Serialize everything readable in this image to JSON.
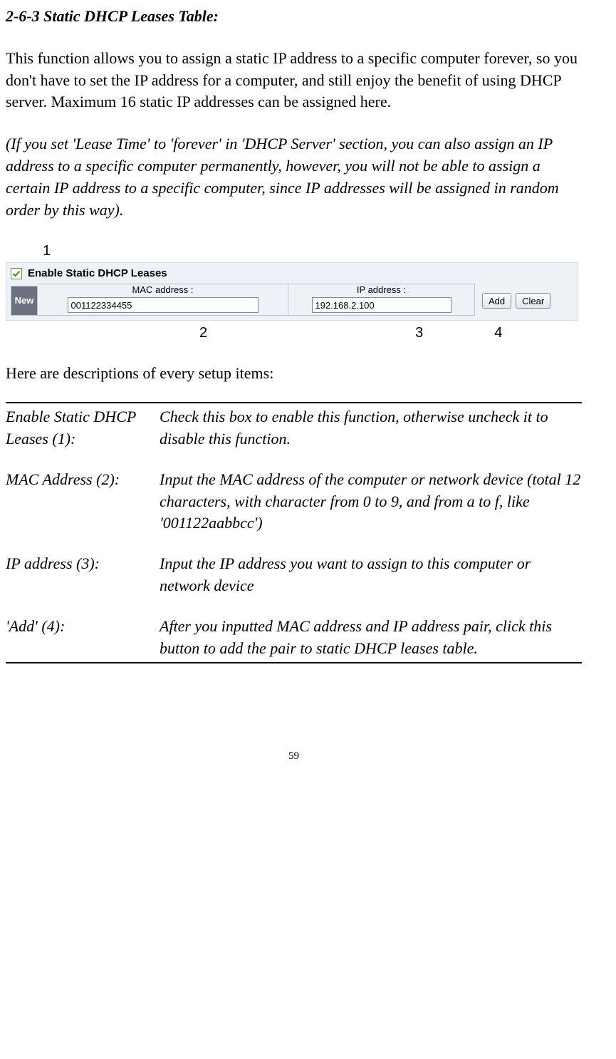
{
  "heading": "2-6-3 Static DHCP Leases Table:",
  "para1": "This function allows you to assign a static IP address to a specific computer forever, so you don't have to set the IP address for a computer, and still enjoy the benefit of using DHCP server. Maximum 16 static IP addresses can be assigned here.",
  "para2": "(If you set 'Lease Time' to 'forever' in 'DHCP Server' section, you can also assign an IP address to a specific computer permanently, however, you will not be able to assign a certain IP address to a specific computer, since IP addresses will be assigned in random order by this way).",
  "callout": {
    "c1": "1",
    "c2": "2",
    "c3": "3",
    "c4": "4"
  },
  "dhcp": {
    "enable_label": "Enable Static DHCP Leases",
    "mac_header": "MAC address :",
    "ip_header": "IP address :",
    "new_label": "New",
    "mac_value": "001122334455",
    "ip_value": "192.168.2.100",
    "add_btn": "Add",
    "clear_btn": "Clear"
  },
  "items_lead": "Here are descriptions of every setup items:",
  "items": [
    {
      "label": "Enable Static DHCP Leases (1):",
      "desc": "Check this box to enable this function, otherwise uncheck it to disable this function."
    },
    {
      "label": "MAC Address (2):",
      "desc": "Input the MAC address of the computer or network device (total 12 characters, with character from 0 to 9, and from a to f, like '001122aabbcc')"
    },
    {
      "label": "IP address (3):",
      "desc": "Input the IP address you want to assign to this computer or network device"
    },
    {
      "label": "'Add' (4):",
      "desc": "After you inputted MAC address and IP address pair, click this button to add the pair to static DHCP leases table."
    }
  ],
  "page_number": "59"
}
